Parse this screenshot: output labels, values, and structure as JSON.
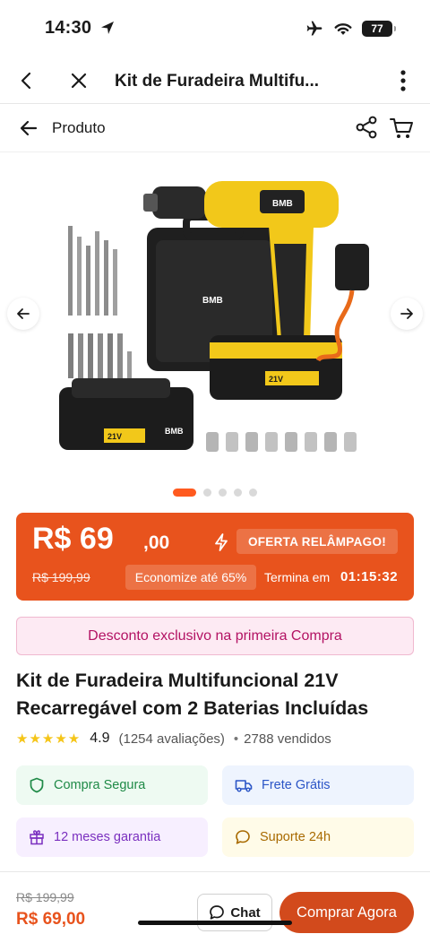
{
  "status_bar": {
    "time": "14:30",
    "battery": "77"
  },
  "top_nav": {
    "title": "Kit de Furadeira Multifu..."
  },
  "product_header": {
    "label": "Produto"
  },
  "carousel": {
    "slide_count": 5,
    "active_index": 0,
    "brand_text": "BMB",
    "battery_label": "21V"
  },
  "price": {
    "main": "R$ 69",
    "cents": ",00",
    "flash_badge": "OFERTA RELÂMPAGO!",
    "old": "R$ 199,99",
    "save": "Economize até 65%",
    "ends_label": "Termina em",
    "ends_time": "01:15:32"
  },
  "discount_banner": "Desconto exclusivo na primeira Compra",
  "product": {
    "title_line1": "Kit de Furadeira Multifuncional 21V",
    "title_line2": "Recarregável com 2 Baterias Incluídas"
  },
  "rating": {
    "stars": "★★★★★",
    "value": "4.9",
    "reviews": "(1254 avaliações)",
    "bullet": "•",
    "sold": "2788 vendidos"
  },
  "features": [
    {
      "label": "Compra Segura",
      "icon": "shield-icon"
    },
    {
      "label": "Frete Grátis",
      "icon": "truck-icon"
    },
    {
      "label": "12 meses garantia",
      "icon": "gift-icon"
    },
    {
      "label": "Suporte 24h",
      "icon": "chat-bubble-icon"
    }
  ],
  "bottom_bar": {
    "old_price": "R$ 199,99",
    "price": "R$ 69,00",
    "chat_label": "Chat",
    "buy_label": "Comprar Agora"
  },
  "colors": {
    "accent": "#e8531d",
    "buy": "#d24a1c",
    "discount_text": "#b31263",
    "star": "#f5c518"
  }
}
